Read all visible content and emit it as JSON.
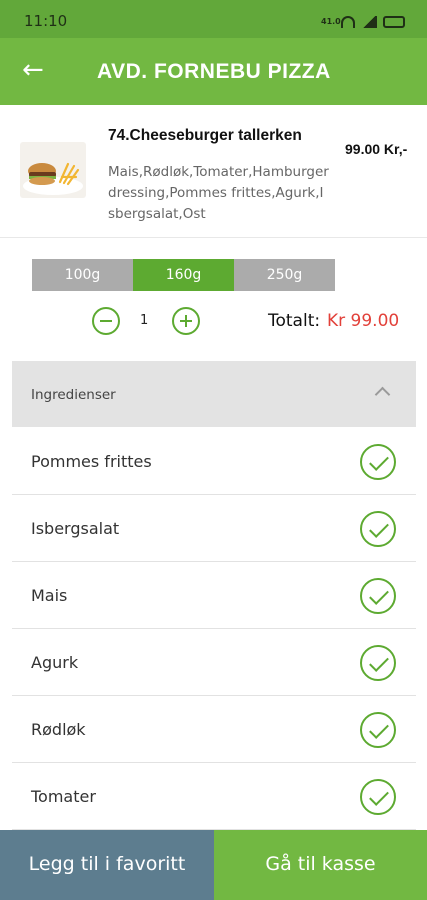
{
  "status_bar": {
    "time": "11:10",
    "network_label": "41.0"
  },
  "header": {
    "title": "AVD. FORNEBU PIZZA"
  },
  "product": {
    "name": "74.Cheeseburger tallerken",
    "price": "99.00 Kr,-",
    "description": "Mais,Rødløk,Tomater,Hamburger dressing,Pommes frittes,Agurk,Isbergsalat,Ost"
  },
  "sizes": [
    {
      "label": "100g",
      "selected": false
    },
    {
      "label": "160g",
      "selected": true
    },
    {
      "label": "250g",
      "selected": false
    }
  ],
  "quantity": {
    "value": "1"
  },
  "total": {
    "label": "Totalt:",
    "value": "Kr 99.00"
  },
  "ingredients": {
    "title": "Ingredienser",
    "items": [
      {
        "label": "Pommes frittes",
        "checked": true
      },
      {
        "label": "Isbergsalat",
        "checked": true
      },
      {
        "label": "Mais",
        "checked": true
      },
      {
        "label": "Agurk",
        "checked": true
      },
      {
        "label": "Rødløk",
        "checked": true
      },
      {
        "label": "Tomater",
        "checked": true
      }
    ]
  },
  "actions": {
    "favorite": "Legg til i favoritt",
    "checkout": "Gå til kasse"
  },
  "colors": {
    "primary_green": "#72b842",
    "accent_green": "#5daa31",
    "price_red": "#e2413a",
    "favorite_button": "#5d7d8f"
  }
}
